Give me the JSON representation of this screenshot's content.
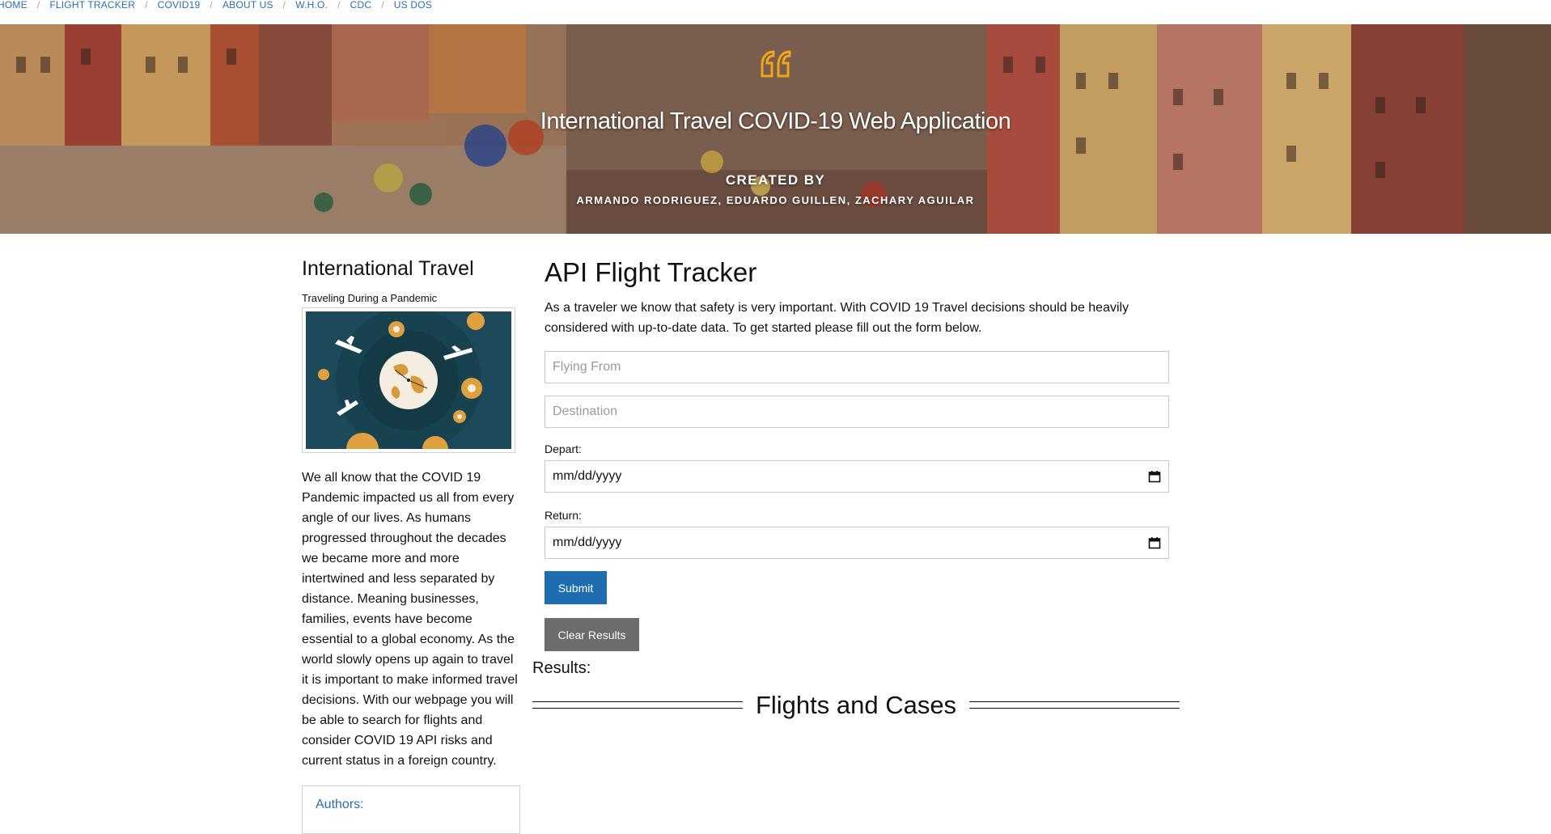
{
  "nav": {
    "items": [
      {
        "label": "HOME"
      },
      {
        "label": "FLIGHT TRACKER"
      },
      {
        "label": "COVID19"
      },
      {
        "label": "ABOUT US"
      },
      {
        "label": "W.H.O."
      },
      {
        "label": "CDC"
      },
      {
        "label": "US DOS"
      }
    ],
    "separator": "/"
  },
  "hero": {
    "quote_icon": "quote-icon",
    "title": "International Travel COVID-19 Web Application",
    "created_by": "CREATED BY",
    "authors": "ARMANDO RODRIGUEZ, EDUARDO GUILLEN, ZACHARY AGUILAR"
  },
  "sidebar": {
    "heading": "International Travel",
    "subtitle": "Traveling During a Pandemic",
    "image_icon": "globe-airplanes-virus-illustration",
    "body": "We all know that the COVID 19 Pandemic impacted us all from every angle of our lives. As humans progressed throughout the decades we became more and more intertwined and less separated by distance. Meaning businesses, families, events have become essential to a global economy. As the world slowly opens up again to travel it is important to make informed travel decisions. With our webpage you will be able to search for flights and consider COVID 19 API risks and current status in a foreign country.",
    "authors_label": "Authors:"
  },
  "main": {
    "heading": "API Flight Tracker",
    "lead": "As a traveler we know that safety is very important. With COVID 19 Travel decisions should be heavily considered with up-to-date data. To get started please fill out the form below.",
    "from_placeholder": "Flying From",
    "destination_placeholder": "Destination",
    "depart_label": "Depart:",
    "depart_value": "mm/dd/yyyy",
    "return_label": "Return:",
    "return_value": "mm/dd/yyyy",
    "submit_label": "Submit",
    "clear_label": "Clear Results",
    "results_label": "Results:",
    "section_title": "Flights and Cases"
  },
  "colors": {
    "link": "#2a6db3",
    "submit": "#1f6db1",
    "clear": "#6c6c6c",
    "quote": "#f0a818"
  }
}
